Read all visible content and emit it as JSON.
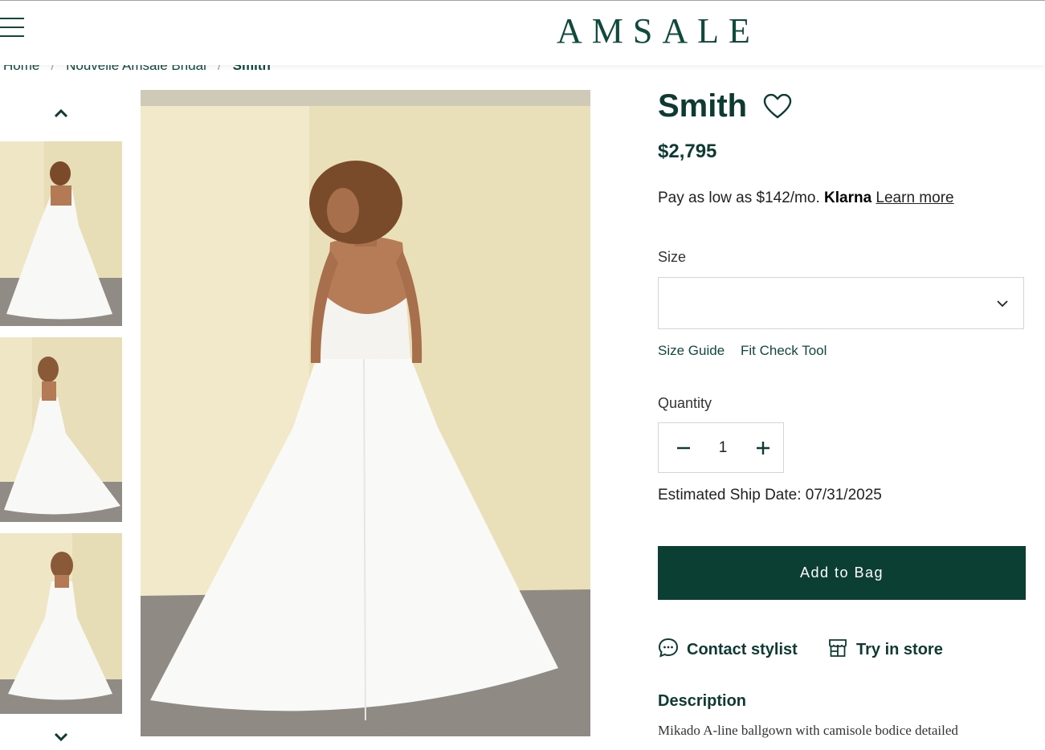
{
  "header": {
    "logo": "AMSALE"
  },
  "breadcrumb": [
    "Home",
    "Nouvelle Amsale Bridal",
    "Smith"
  ],
  "product": {
    "title": "Smith",
    "price": "$2,795",
    "klarna": {
      "prefix": "Pay as low as $142/mo.",
      "brand": "Klarna",
      "link": "Learn more"
    },
    "size_label": "Size",
    "size_value": "",
    "size_guide": "Size Guide",
    "fit_check": "Fit Check Tool",
    "quantity_label": "Quantity",
    "quantity": "1",
    "ship_date": "Estimated Ship Date: 07/31/2025",
    "add_to_bag": "Add to Bag",
    "contact_stylist": "Contact stylist",
    "try_in_store": "Try in store",
    "description_heading": "Description",
    "description_text": "Mikado A-line ballgown with camisole bodice detailed"
  },
  "gallery": {
    "thumbnails": [
      "back-view",
      "side-view",
      "front-view"
    ],
    "main": "back-view"
  },
  "colors": {
    "brand": "#0f4a3c",
    "button": "#0b3f33",
    "wall": "#eee5c3",
    "floor": "#8f8a84",
    "dress": "#f7f7f5"
  }
}
